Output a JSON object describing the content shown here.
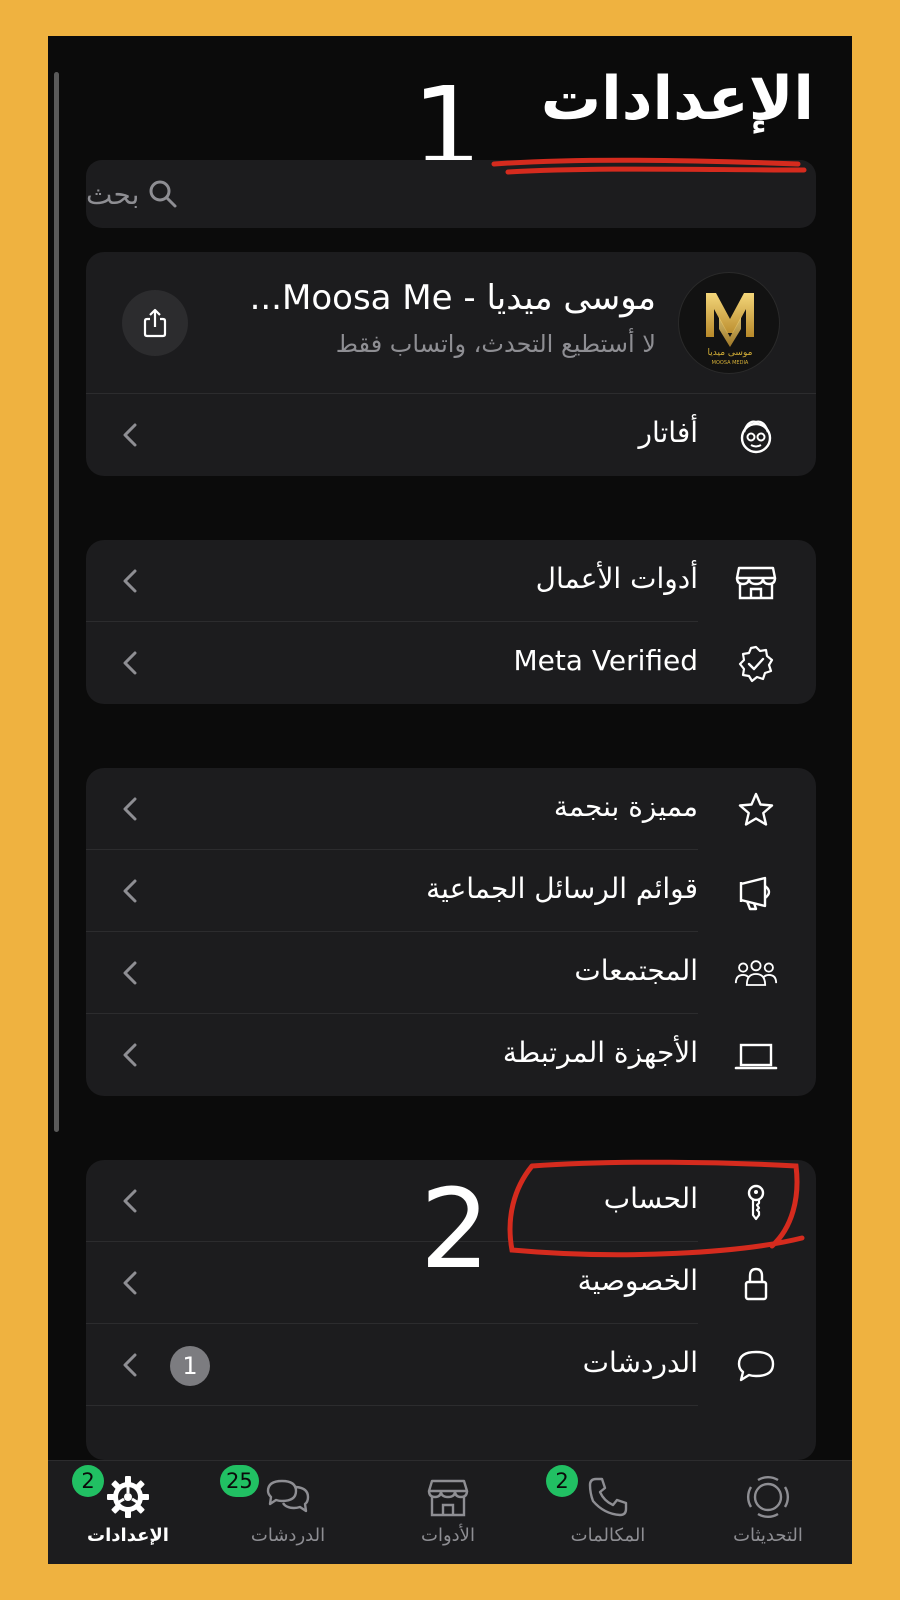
{
  "header": {
    "title": "الإعدادات"
  },
  "annotations": {
    "step1": "1",
    "step2": "2",
    "highlight_color": "#D52B1E"
  },
  "search": {
    "placeholder": "بحث",
    "icon": "search-icon"
  },
  "profile": {
    "name": "موسى ميديا - Moosa Me...",
    "status": "لا أستطيع التحدث، واتساب فقط",
    "logo_title": "موسى ميديا",
    "logo_subtitle": "MOOSA MEDIA",
    "share_icon": "share-icon"
  },
  "group1": [
    {
      "label": "أفاتار",
      "icon": "avatar-face-icon"
    }
  ],
  "group2": [
    {
      "label": "أدوات الأعمال",
      "icon": "store-icon"
    },
    {
      "label": "Meta Verified",
      "icon": "verified-badge-icon"
    }
  ],
  "group3": [
    {
      "label": "مميزة بنجمة",
      "icon": "star-icon"
    },
    {
      "label": "قوائم الرسائل الجماعية",
      "icon": "megaphone-icon"
    },
    {
      "label": "المجتمعات",
      "icon": "communities-icon"
    },
    {
      "label": "الأجهزة المرتبطة",
      "icon": "laptop-icon"
    }
  ],
  "group4": [
    {
      "label": "الحساب",
      "icon": "key-icon"
    },
    {
      "label": "الخصوصية",
      "icon": "lock-icon"
    },
    {
      "label": "الدردشات",
      "icon": "chat-bubble-icon",
      "badge": "1"
    }
  ],
  "tabs": [
    {
      "label": "الإعدادات",
      "badge": "2",
      "icon": "settings-gear-icon",
      "active": true
    },
    {
      "label": "الدردشات",
      "badge": "25",
      "icon": "chats-icon"
    },
    {
      "label": "الأدوات",
      "icon": "tools-store-icon"
    },
    {
      "label": "المكالمات",
      "badge": "2",
      "icon": "phone-icon"
    },
    {
      "label": "التحديثات",
      "icon": "updates-icon"
    }
  ],
  "colors": {
    "frame": "#EFB240",
    "background": "#0B0B0B",
    "card": "#1C1C1E",
    "badge_green": "#21C063",
    "logo_gold": "#D4AF37"
  }
}
